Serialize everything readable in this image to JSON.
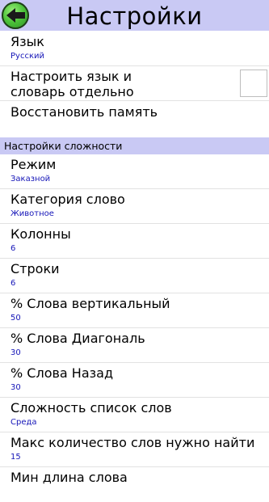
{
  "header": {
    "title": "Настройки",
    "back_icon": "back-arrow-icon"
  },
  "general": [
    {
      "label": "Язык",
      "value": "Русский"
    },
    {
      "label": "Настроить язык и словарь отдельно",
      "checked": false
    },
    {
      "label": "Восстановить память"
    }
  ],
  "difficulty_section": {
    "title": "Настройки сложности",
    "items": [
      {
        "label": "Режим",
        "value": "Заказной"
      },
      {
        "label": "Категория слово",
        "value": "Животное"
      },
      {
        "label": "Колонны",
        "value": "6"
      },
      {
        "label": "Строки",
        "value": "6"
      },
      {
        "label": "% Слова вертикальный",
        "value": "50"
      },
      {
        "label": "% Слова Диагональ",
        "value": "30"
      },
      {
        "label": "% Слова Назад",
        "value": "30"
      },
      {
        "label": "Сложность список слов",
        "value": "Среда"
      },
      {
        "label": "Макс количество слов нужно найти",
        "value": "15"
      },
      {
        "label": "Мин длина слова"
      }
    ]
  },
  "colors": {
    "header_bg": "#c9c9f4",
    "value_text": "#1616b8"
  }
}
